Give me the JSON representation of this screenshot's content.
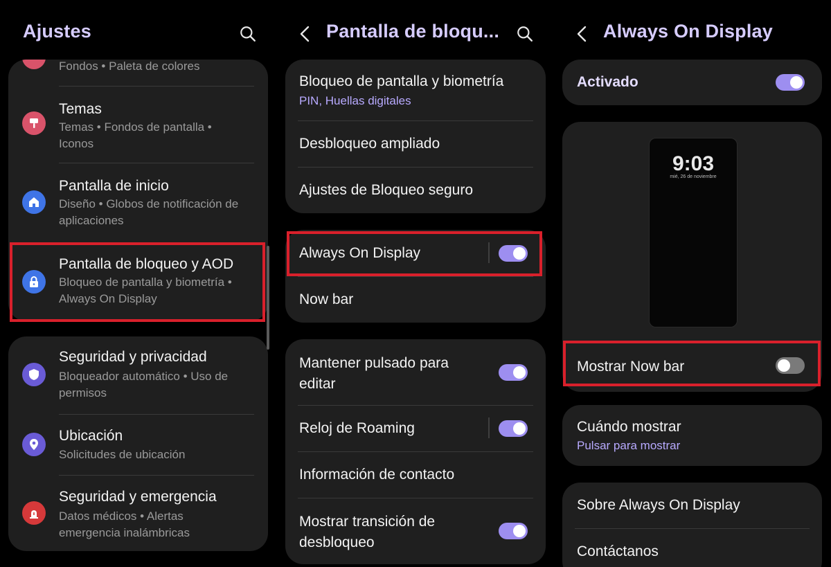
{
  "panel1": {
    "title": "Ajustes",
    "items": [
      {
        "title": "",
        "subtitle": "Fondos • Paleta de colores",
        "icon": "palette-icon",
        "color": "#d9536a"
      },
      {
        "title": "Temas",
        "subtitle": "Temas • Fondos de pantalla • Iconos",
        "icon": "brush-icon",
        "color": "#d9536a"
      },
      {
        "title": "Pantalla de inicio",
        "subtitle": "Diseño • Globos de notificación de aplicaciones",
        "icon": "home-icon",
        "color": "#3f74e6"
      },
      {
        "title": "Pantalla de bloqueo y AOD",
        "subtitle": "Bloqueo de pantalla y biometría • Always On Display",
        "icon": "lock-icon",
        "color": "#3f74e6"
      },
      {
        "title": "Seguridad y privacidad",
        "subtitle": "Bloqueador automático • Uso de permisos",
        "icon": "shield-icon",
        "color": "#6a5bd6"
      },
      {
        "title": "Ubicación",
        "subtitle": "Solicitudes de ubicación",
        "icon": "location-pin-icon",
        "color": "#6a5bd6"
      },
      {
        "title": "Seguridad y emergencia",
        "subtitle": "Datos médicos • Alertas emergencia inalámbricas",
        "icon": "emergency-icon",
        "color": "#d6393a"
      }
    ]
  },
  "panel2": {
    "title": "Pantalla de bloqu...",
    "group1": [
      {
        "title": "Bloqueo de pantalla y biometría",
        "subtitle": "PIN, Huellas digitales"
      },
      {
        "title": "Desbloqueo ampliado"
      },
      {
        "title": "Ajustes de Bloqueo seguro"
      }
    ],
    "group2": [
      {
        "title": "Always On Display",
        "toggle": true
      },
      {
        "title": "Now bar"
      }
    ],
    "group3": [
      {
        "title": "Mantener pulsado para editar",
        "toggle": true
      },
      {
        "title": "Reloj de Roaming",
        "toggle": true
      },
      {
        "title": "Información de contacto"
      },
      {
        "title": "Mostrar transición de desbloqueo",
        "toggle": true
      }
    ]
  },
  "panel3": {
    "title": "Always On Display",
    "master": {
      "label": "Activado",
      "toggle": true
    },
    "preview": {
      "time": "9:03",
      "date": "mié, 26 de noviembre"
    },
    "show_now_bar": {
      "label": "Mostrar Now bar",
      "toggle": false
    },
    "when": {
      "title": "Cuándo mostrar",
      "subtitle": "Pulsar para mostrar"
    },
    "about": [
      {
        "title": "Sobre Always On Display"
      },
      {
        "title": "Contáctanos"
      }
    ]
  },
  "colors": {
    "header_accent": "#d6ccff",
    "toggle_on": "#9d8ef0",
    "highlight_border": "#d9202b",
    "card_bg": "#1f1f1f"
  }
}
